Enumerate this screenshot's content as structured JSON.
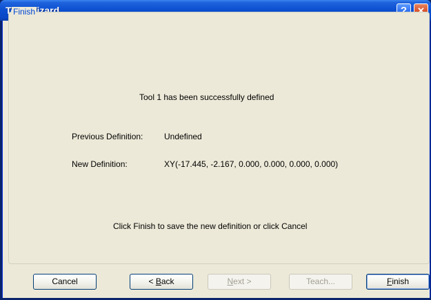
{
  "window": {
    "title": "Tool Wizard",
    "help_glyph": "?",
    "close_glyph": "✕"
  },
  "group": {
    "label": "Finish"
  },
  "content": {
    "success_message": "Tool 1 has been successfully defined",
    "previous_label": "Previous Definition:",
    "previous_value": "Undefined",
    "new_label": "New Definition:",
    "new_value": "XY(-17.445, -2.167, 0.000, 0.000, 0.000, 0.000)",
    "instruction": "Click Finish to save the new definition or click Cancel"
  },
  "buttons": {
    "cancel": "Cancel",
    "back_prefix": "< ",
    "back_key": "B",
    "back_rest": "ack",
    "next_key": "N",
    "next_rest": "ext >",
    "teach": "Teach...",
    "finish_key": "F",
    "finish_rest": "inish"
  },
  "colors": {
    "title_bar": "#0a48c6",
    "dialog_bg": "#ece9d8",
    "group_label": "#0046d5",
    "close_button": "#d8522c"
  }
}
